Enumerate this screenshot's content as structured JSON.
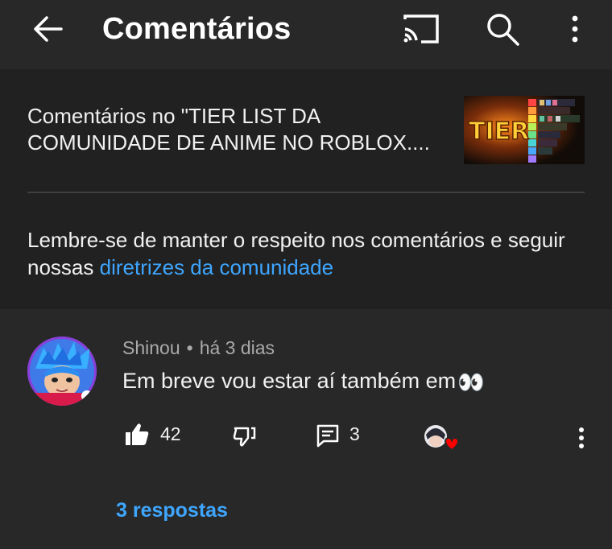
{
  "topbar": {
    "title": "Comentários",
    "icons": [
      "arrow-left-icon",
      "cast-icon",
      "search-icon",
      "more-vertical-icon"
    ]
  },
  "video": {
    "title_line1": "Comentários no \"TIER LIST DA",
    "title_line2": "COMUNIDADE DE ANIME NO ROBLOX....",
    "thumbnail_text": "TIER"
  },
  "guidelines": {
    "text": "Lembre-se de manter o respeito nos comentários e seguir nossas ",
    "link": "diretrizes da comunidade"
  },
  "comment": {
    "author": "Shinou",
    "separator": "•",
    "time": "há 3 dias",
    "text": "Em breve vou estar aí também em",
    "emoji": "👀",
    "likes": "42",
    "replies_count": "3",
    "replies_link": "3 respostas"
  },
  "colors": {
    "background": "#282828",
    "header_panel": "#212121",
    "link": "#3ea6ff",
    "heart": "#ff0000"
  }
}
